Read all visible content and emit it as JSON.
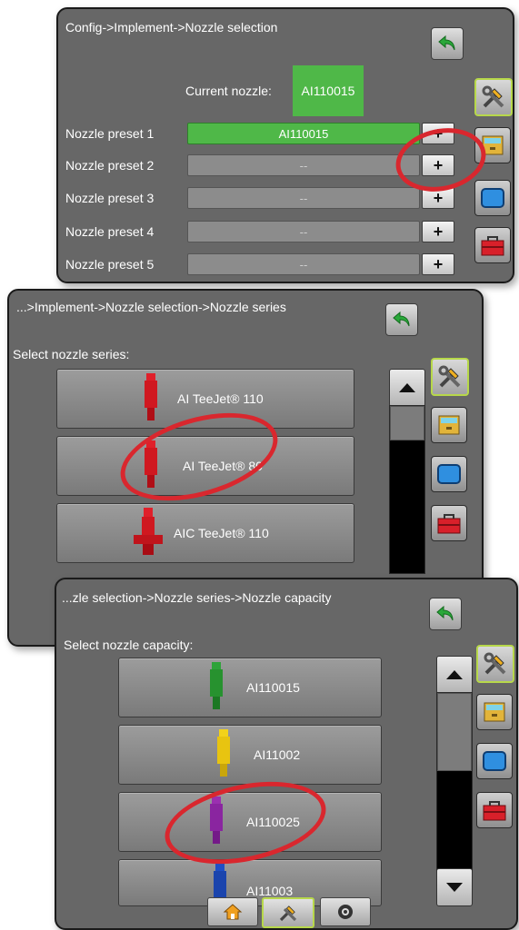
{
  "panel1": {
    "breadcrumb": "Config->Implement->Nozzle selection",
    "current_nozzle_label": "Current nozzle:",
    "current_nozzle_value": "AI110015",
    "presets": [
      {
        "label": "Nozzle preset 1",
        "value": "AI110015",
        "selected": true
      },
      {
        "label": "Nozzle preset 2",
        "value": "--",
        "selected": false
      },
      {
        "label": "Nozzle preset 3",
        "value": "--",
        "selected": false
      },
      {
        "label": "Nozzle preset 4",
        "value": "--",
        "selected": false
      },
      {
        "label": "Nozzle preset 5",
        "value": "--",
        "selected": false
      }
    ],
    "plus_label": "+"
  },
  "panel2": {
    "breadcrumb": "...>Implement->Nozzle selection->Nozzle series",
    "prompt": "Select nozzle series:",
    "items": [
      {
        "label": "AI TeeJet® 110"
      },
      {
        "label": "AI TeeJet® 80"
      },
      {
        "label": "AIC TeeJet® 110"
      }
    ]
  },
  "panel3": {
    "breadcrumb": "...zle selection->Nozzle series->Nozzle capacity",
    "prompt": "Select nozzle capacity:",
    "items": [
      {
        "label": "AI110015",
        "color": "#2fa33a"
      },
      {
        "label": "AI11002",
        "color": "#f2d21a"
      },
      {
        "label": "AI110025",
        "color": "#9b2fb0"
      },
      {
        "label": "AI11003",
        "color": "#1f4fc6"
      }
    ]
  },
  "icons": {
    "back": "back-arrow-icon",
    "tools": "wrench-hammer-icon",
    "data": "data-drawer-icon",
    "display": "display-screen-icon",
    "toolbox": "toolbox-icon",
    "home": "home-icon",
    "guidance": "camera-icon"
  },
  "colors": {
    "panel_bg": "#676767",
    "selected_green": "#4fb848",
    "highlight_ring": "#d9272e",
    "active_border": "#b7d84a"
  }
}
